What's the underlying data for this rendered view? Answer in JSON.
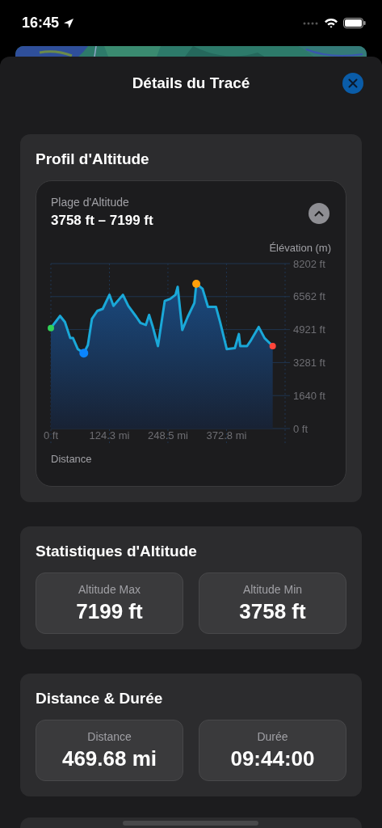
{
  "status_bar": {
    "time": "16:45"
  },
  "sheet": {
    "title": "Détails du Tracé"
  },
  "profile": {
    "title": "Profil d'Altitude",
    "range_label": "Plage d'Altitude",
    "range_value": "3758 ft – 7199 ft",
    "expanded": true,
    "chart_data": {
      "type": "area",
      "ylabel": "Élévation (m)",
      "xlabel": "Distance",
      "xlim": [
        0,
        497.2
      ],
      "ylim": [
        0,
        8202
      ],
      "x": [
        0,
        19.5,
        29.8,
        41.2,
        47,
        57.3,
        69.9,
        78.5,
        87.1,
        98.5,
        110,
        124.3,
        132.9,
        152.9,
        164.4,
        181.6,
        190.2,
        201.6,
        208.5,
        215.9,
        227.4,
        241.7,
        253.2,
        264.6,
        269.2,
        278.9,
        290.4,
        304.7,
        308.7,
        321.9,
        333.4,
        350.5,
        359.1,
        373.5,
        390.6,
        399.2,
        402.1,
        416.4,
        425,
        441.1,
        453.7,
        470.9
      ],
      "grid": true,
      "values": [
        5000,
        5600,
        5300,
        4500,
        4500,
        3950,
        3750,
        4150,
        5450,
        5850,
        5950,
        6650,
        6100,
        6650,
        6100,
        5550,
        5250,
        5150,
        5650,
        5100,
        4100,
        6350,
        6450,
        6650,
        7050,
        4900,
        5550,
        6250,
        7200,
        6950,
        6050,
        6050,
        5300,
        3950,
        4000,
        4700,
        4100,
        4100,
        4400,
        5050,
        4500,
        4100
      ],
      "xticks": [
        {
          "value": 0,
          "label": "0 ft"
        },
        {
          "value": 124.3,
          "label": "124.3 mi"
        },
        {
          "value": 248.5,
          "label": "248.5 mi"
        },
        {
          "value": 372.8,
          "label": "372.8 mi"
        }
      ],
      "yticks": [
        {
          "value": 0,
          "label": "0 ft"
        },
        {
          "value": 1640,
          "label": "1640 ft"
        },
        {
          "value": 3281,
          "label": "3281 ft"
        },
        {
          "value": 4921,
          "label": "4921 ft"
        },
        {
          "value": 6562,
          "label": "6562 ft"
        },
        {
          "value": 8202,
          "label": "8202 ft"
        }
      ]
    }
  },
  "sections": [
    {
      "title": "Statistiques d'Altitude",
      "stats": [
        {
          "label": "Altitude Max",
          "value": "7199 ft"
        },
        {
          "label": "Altitude Min",
          "value": "3758 ft"
        }
      ]
    },
    {
      "title": "Distance & Durée",
      "stats": [
        {
          "label": "Distance",
          "value": "469.68 mi"
        },
        {
          "label": "Durée",
          "value": "09:44:00"
        }
      ]
    }
  ]
}
